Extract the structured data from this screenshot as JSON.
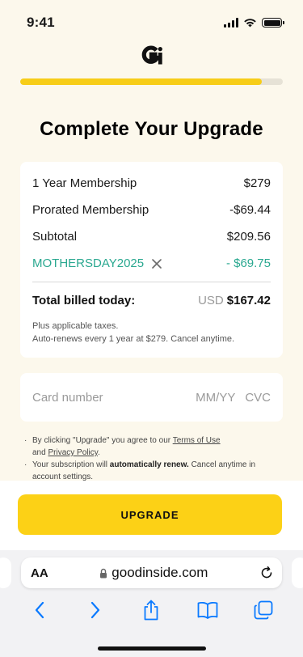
{
  "status_bar": {
    "time": "9:41"
  },
  "progress": {
    "fraction": 0.92
  },
  "page": {
    "title": "Complete Your Upgrade"
  },
  "summary": {
    "items": [
      {
        "label": "1 Year Membership",
        "amount": "$279"
      },
      {
        "label": "Prorated Membership",
        "amount": "-$69.44"
      },
      {
        "label": "Subtotal",
        "amount": "$209.56"
      }
    ],
    "promo": {
      "code": "MOTHERSDAY2025",
      "amount": "- $69.75"
    },
    "total": {
      "label": "Total billed today:",
      "currency": "USD",
      "amount": "$167.42"
    },
    "fine_print_1": "Plus applicable taxes.",
    "fine_print_2": "Auto-renews every 1 year at $279. Cancel anytime."
  },
  "card": {
    "number_placeholder": "Card number",
    "expiry_placeholder": "MM/YY",
    "cvc_placeholder": "CVC"
  },
  "legal": {
    "line1_prefix": "By clicking \"Upgrade\" you agree to our ",
    "terms_link": "Terms of Use",
    "line1_and": "and ",
    "privacy_link": "Privacy Policy",
    "line1_end": ".",
    "line2_prefix": "Your subscription will ",
    "line2_bold": "automatically renew.",
    "line2_suffix": "  Cancel anytime in account settings."
  },
  "cta": {
    "label": "UPGRADE"
  },
  "browser": {
    "aa_label": "AA",
    "url": "goodinside.com"
  },
  "colors": {
    "accent": "#fcd116",
    "promo": "#2aa890",
    "background": "#fcf8ec",
    "browser_blue": "#0a7aff"
  }
}
